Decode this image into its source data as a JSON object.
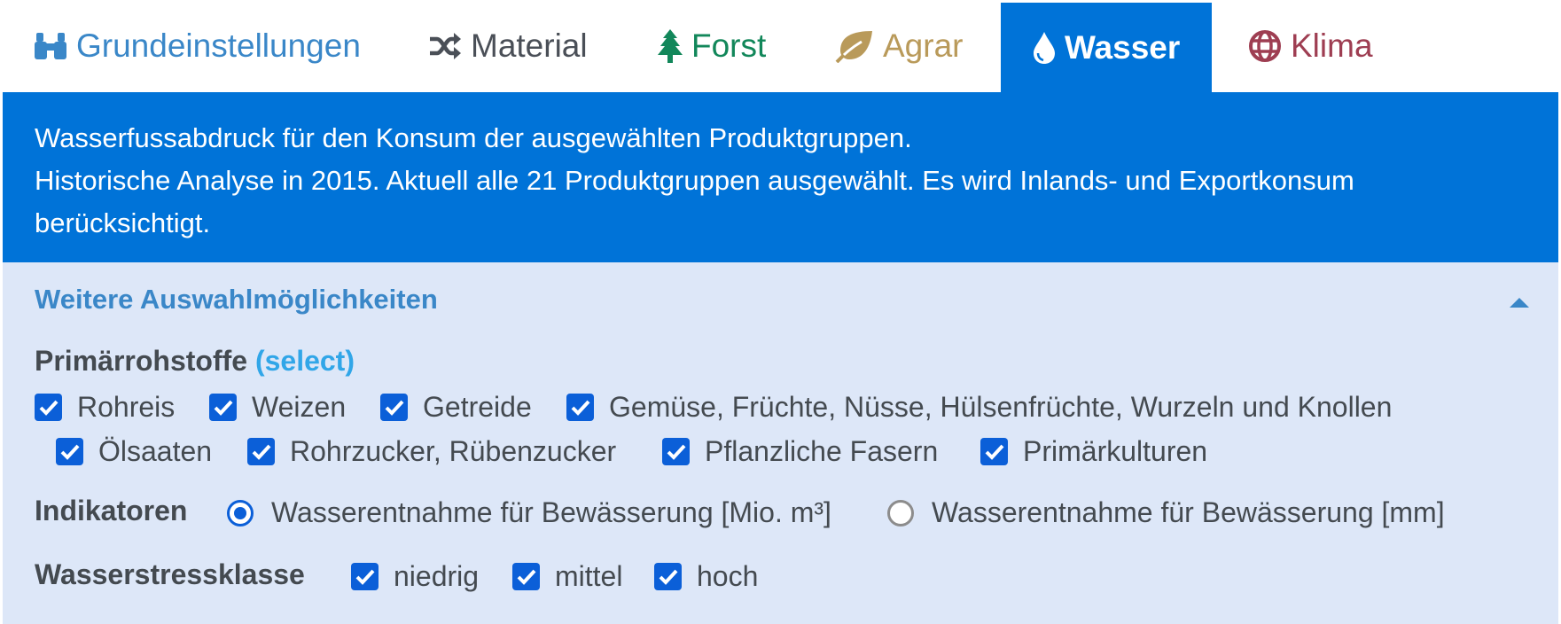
{
  "tabs": [
    {
      "label": "Grundeinstellungen",
      "icon": "binoculars-icon",
      "color": "#3a87c8"
    },
    {
      "label": "Material",
      "icon": "shuffle-icon",
      "color": "#4a4f57"
    },
    {
      "label": "Forst",
      "icon": "tree-icon",
      "color": "#12875a"
    },
    {
      "label": "Agrar",
      "icon": "leaf-icon",
      "color": "#b99a5a"
    },
    {
      "label": "Wasser",
      "icon": "droplet-icon",
      "color": "#ffffff",
      "active": true
    },
    {
      "label": "Klima",
      "icon": "globe-icon",
      "color": "#9e3e52"
    }
  ],
  "info": {
    "line1": "Wasserfussabdruck für den Konsum der ausgewählten Produktgruppen.",
    "line2": "Historische Analyse in 2015. Aktuell alle 21 Produktgruppen ausgewählt. Es wird Inlands- und Exportkonsum berücksichtigt."
  },
  "more": {
    "title": "Weitere Auswahlmöglichkeiten",
    "toggle_icon": "caret-up-icon"
  },
  "primaer": {
    "label": "Primärrohstoffe",
    "select_link": "(select)",
    "items": [
      {
        "label": "Rohreis",
        "checked": true
      },
      {
        "label": "Weizen",
        "checked": true
      },
      {
        "label": "Getreide",
        "checked": true
      },
      {
        "label": "Gemüse, Früchte, Nüsse, Hülsenfrüchte, Wurzeln und Knollen",
        "checked": true
      },
      {
        "label": "Ölsaaten",
        "checked": true
      },
      {
        "label": "Rohrzucker, Rübenzucker",
        "checked": true
      },
      {
        "label": "Pflanzliche Fasern",
        "checked": true
      },
      {
        "label": "Primärkulturen",
        "checked": true
      }
    ]
  },
  "indikatoren": {
    "label": "Indikatoren",
    "options": [
      {
        "label": "Wasserentnahme für Bewässerung [Mio. m³]",
        "selected": true
      },
      {
        "label": "Wasserentnahme für Bewässerung [mm]",
        "selected": false
      }
    ]
  },
  "stress": {
    "label": "Wasserstressklasse",
    "items": [
      {
        "label": "niedrig",
        "checked": true
      },
      {
        "label": "mittel",
        "checked": true
      },
      {
        "label": "hoch",
        "checked": true
      }
    ]
  },
  "colors": {
    "accent": "#0073d8",
    "panel": "#dde7f8",
    "checkbox": "#0b5fd8",
    "link": "#31a6e8"
  }
}
